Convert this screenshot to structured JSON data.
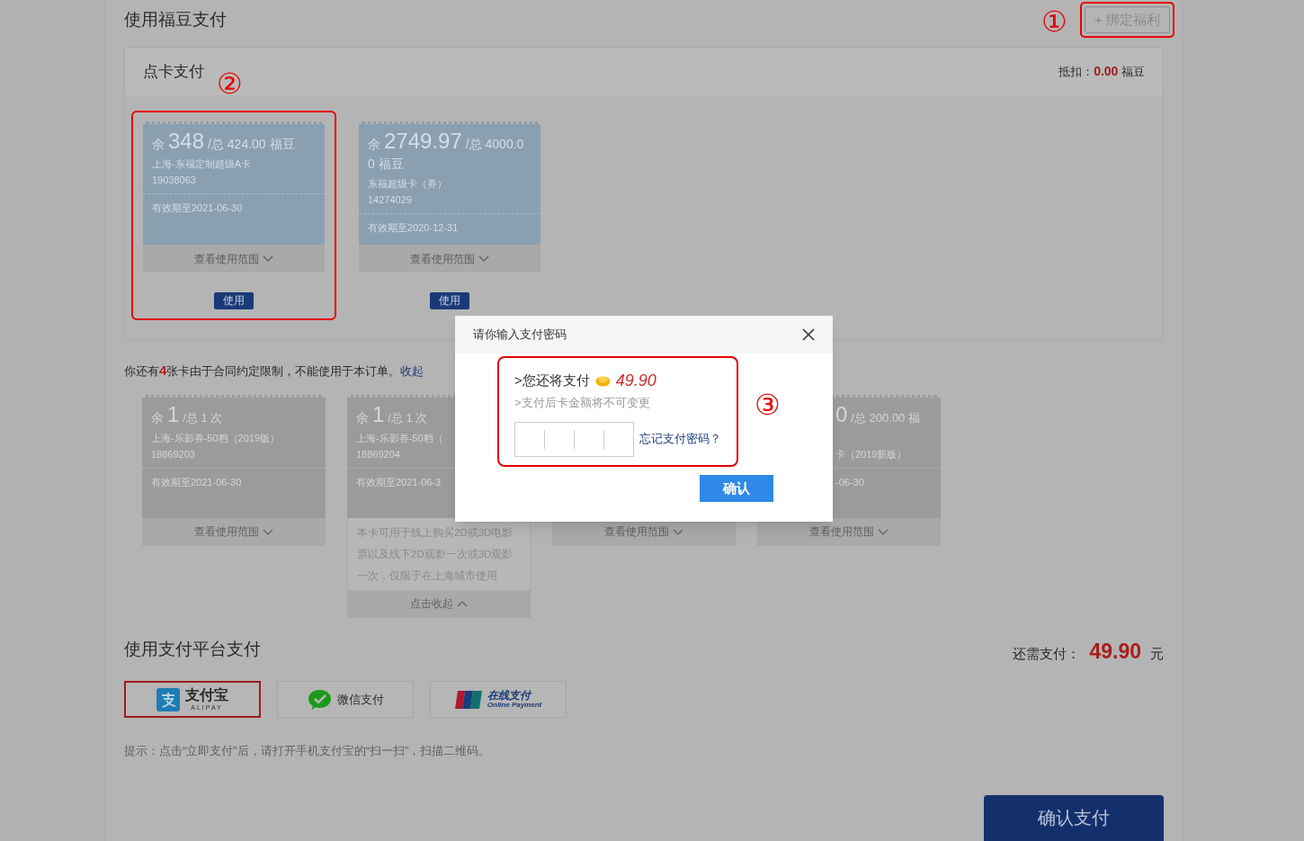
{
  "fudou": {
    "title": "使用福豆支付",
    "marker": "①",
    "bind_button": {
      "label": "+ 绑定福利",
      "highlighted": true
    },
    "card_panel": {
      "title": "点卡支付",
      "marker": "②",
      "deduction_label": "抵扣：",
      "deduction_value": "0.00",
      "deduction_unit": "福豆",
      "cards": [
        {
          "prefix": "余",
          "balance": "348",
          "total": "/总 424.00 福豆",
          "name": "上海-东福定制超级A卡",
          "number": "19038063",
          "expiry": "有效期至2021-06-30",
          "scope": "查看使用范围",
          "use_button": "使用",
          "highlighted": true
        },
        {
          "prefix": "余",
          "balance": "2749.97",
          "total": "/总 4000.00 福豆",
          "name": "东福超级卡（券）",
          "number": "14274029",
          "expiry": "有效期至2020-12-31",
          "scope": "查看使用范围",
          "use_button": "使用",
          "highlighted": false
        }
      ]
    },
    "restricted_notice": "你还有**4**张卡由于合同约定限制，不能使用于本订单。",
    "collapse_link": "收起",
    "restricted_cards": [
      {
        "kind": "full",
        "prefix": "余",
        "balance": "1",
        "total": "/总 1 次",
        "name": "上海-乐影券-50档（2019版）",
        "number": "18869203",
        "expiry": "有效期至2021-06-30",
        "scope": "查看使用范围",
        "expanded": false
      },
      {
        "kind": "clipped-right",
        "prefix": "余",
        "balance": "1",
        "total": "/总 1 次",
        "name": "上海-乐影券-50档（",
        "number": "18869204",
        "expiry": "有效期至2021-06-3",
        "scope": "点击收起",
        "expanded": true,
        "description": "本卡可用于线上购买2D或3D电影票以及线下2D观影一次或3D观影一次，仅限于在上海城市使用"
      },
      {
        "kind": "hidden",
        "scope": "查看使用范围",
        "expanded": false
      },
      {
        "kind": "clipped-left",
        "balance": "0",
        "total": "/总 200.00 福",
        "name": "卡（2019新版）",
        "expiry": "-06-30",
        "scope": "查看使用范围",
        "expanded": false
      }
    ]
  },
  "platform": {
    "title": "使用支付平台支付",
    "due_label": "还需支付：",
    "due_value": "49.90",
    "due_unit": "元",
    "methods": [
      {
        "kind": "alipay",
        "label": "支付宝",
        "sublabel": "ALIPAY",
        "selected": true
      },
      {
        "kind": "wechat",
        "label": "微信支付",
        "selected": false
      },
      {
        "kind": "unionpay",
        "label": "在线支付",
        "sublabel": "Online Payment",
        "selected": false
      }
    ],
    "hint": "提示：点击“立即支付”后，请打开手机支付宝的“扫一扫”，扫描二维码。",
    "confirm_button": "确认支付"
  },
  "dialog": {
    "title": "请你输入支付密码",
    "marker": "③",
    "highlighted": true,
    "pay_label": ">您还将支付",
    "amount": "49.90",
    "note": ">支付后卡金额将不可变更",
    "forgot_link": "忘记支付密码？",
    "confirm": "确认"
  }
}
